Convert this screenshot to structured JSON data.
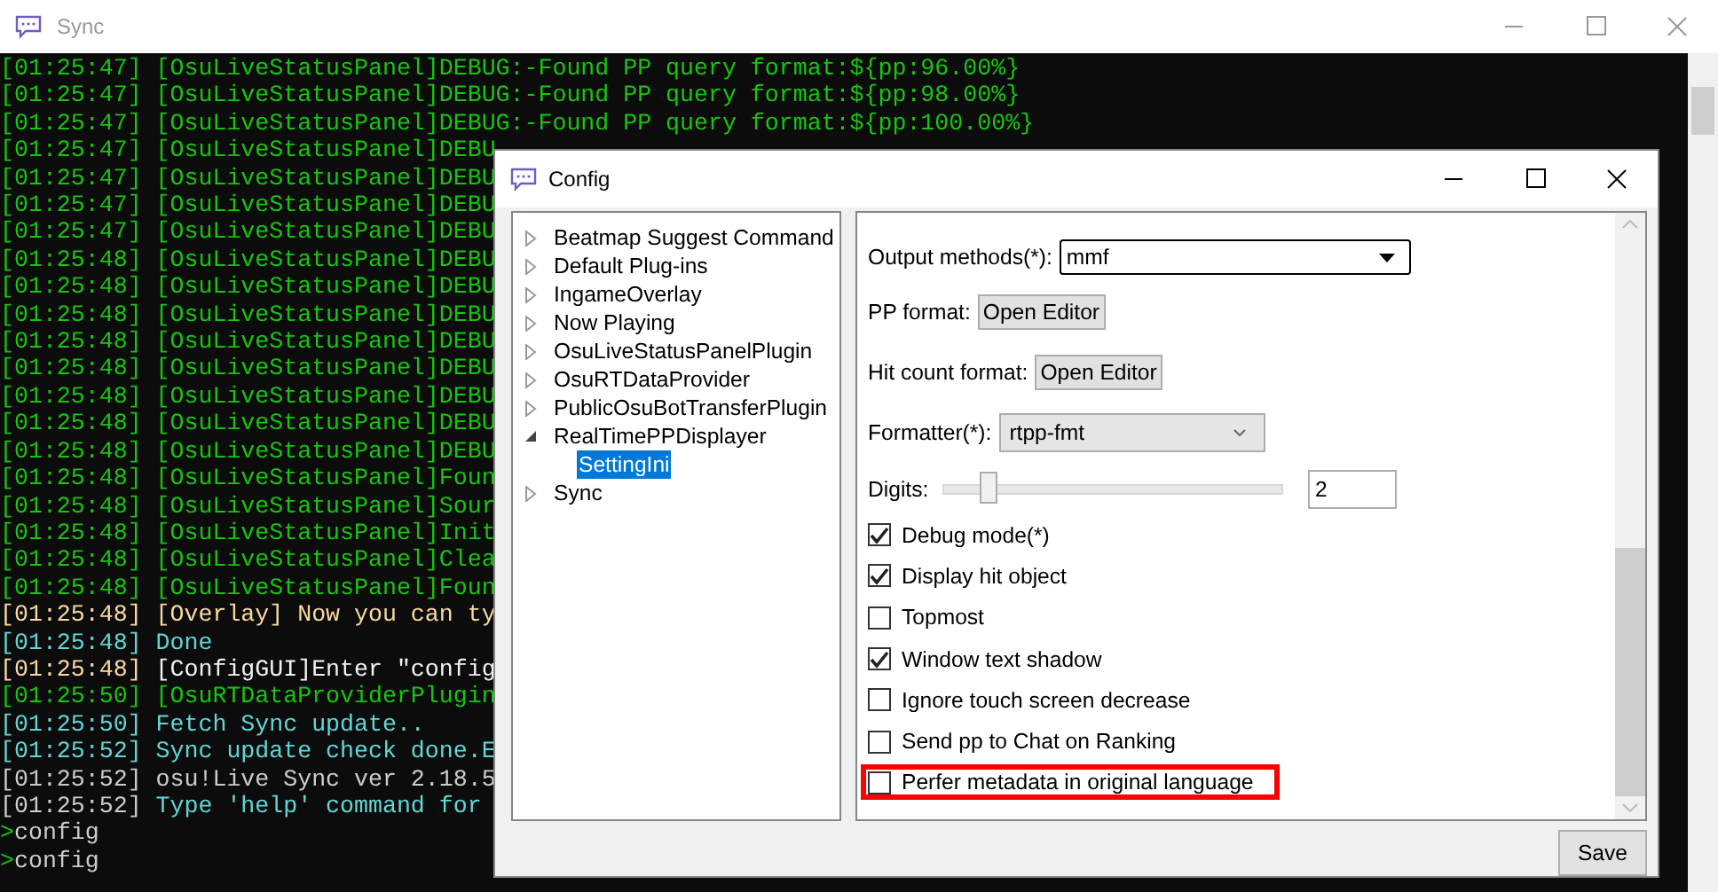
{
  "window": {
    "title": "Sync"
  },
  "console": {
    "lines": [
      {
        "time": {
          "text": "[01:25:47]",
          "color": "#16c60c"
        },
        "message": {
          "text": "[OsuLiveStatusPanel]DEBUG:-Found PP query format:${pp:96.00%}",
          "color": "#16c60c"
        }
      },
      {
        "time": {
          "text": "[01:25:47]",
          "color": "#16c60c"
        },
        "message": {
          "text": "[OsuLiveStatusPanel]DEBUG:-Found PP query format:${pp:98.00%}",
          "color": "#16c60c"
        }
      },
      {
        "time": {
          "text": "[01:25:47]",
          "color": "#16c60c"
        },
        "message": {
          "text": "[OsuLiveStatusPanel]DEBUG:-Found PP query format:${pp:100.00%}",
          "color": "#16c60c"
        }
      },
      {
        "time": {
          "text": "[01:25:47]",
          "color": "#16c60c"
        },
        "message": {
          "text": "[OsuLiveStatusPanel]DEBU",
          "color": "#16c60c"
        }
      },
      {
        "time": {
          "text": "[01:25:47]",
          "color": "#16c60c"
        },
        "message": {
          "text": "[OsuLiveStatusPanel]DEBU",
          "color": "#16c60c"
        }
      },
      {
        "time": {
          "text": "[01:25:47]",
          "color": "#16c60c"
        },
        "message": {
          "text": "[OsuLiveStatusPanel]DEBU",
          "color": "#16c60c"
        }
      },
      {
        "time": {
          "text": "[01:25:47]",
          "color": "#16c60c"
        },
        "message": {
          "text": "[OsuLiveStatusPanel]DEBU",
          "color": "#16c60c"
        }
      },
      {
        "time": {
          "text": "[01:25:48]",
          "color": "#16c60c"
        },
        "message": {
          "text": "[OsuLiveStatusPanel]DEBU",
          "color": "#16c60c"
        }
      },
      {
        "time": {
          "text": "[01:25:48]",
          "color": "#16c60c"
        },
        "message": {
          "text": "[OsuLiveStatusPanel]DEBU",
          "color": "#16c60c"
        }
      },
      {
        "time": {
          "text": "[01:25:48]",
          "color": "#16c60c"
        },
        "message": {
          "text": "[OsuLiveStatusPanel]DEBU",
          "color": "#16c60c"
        }
      },
      {
        "time": {
          "text": "[01:25:48]",
          "color": "#16c60c"
        },
        "message": {
          "text": "[OsuLiveStatusPanel]DEBU",
          "color": "#16c60c"
        }
      },
      {
        "time": {
          "text": "[01:25:48]",
          "color": "#16c60c"
        },
        "message": {
          "text": "[OsuLiveStatusPanel]DEBU",
          "color": "#16c60c"
        }
      },
      {
        "time": {
          "text": "[01:25:48]",
          "color": "#16c60c"
        },
        "message": {
          "text": "[OsuLiveStatusPanel]DEBU",
          "color": "#16c60c"
        }
      },
      {
        "time": {
          "text": "[01:25:48]",
          "color": "#16c60c"
        },
        "message": {
          "text": "[OsuLiveStatusPanel]DEBU",
          "color": "#16c60c"
        }
      },
      {
        "time": {
          "text": "[01:25:48]",
          "color": "#16c60c"
        },
        "message": {
          "text": "[OsuLiveStatusPanel]DEBU",
          "color": "#16c60c"
        }
      },
      {
        "time": {
          "text": "[01:25:48]",
          "color": "#16c60c"
        },
        "message": {
          "text": "[OsuLiveStatusPanel]Foun",
          "color": "#16c60c"
        }
      },
      {
        "time": {
          "text": "[01:25:48]",
          "color": "#16c60c"
        },
        "message": {
          "text": "[OsuLiveStatusPanel]Sour",
          "color": "#16c60c"
        }
      },
      {
        "time": {
          "text": "[01:25:48]",
          "color": "#16c60c"
        },
        "message": {
          "text": "[OsuLiveStatusPanel]Init",
          "color": "#16c60c"
        }
      },
      {
        "time": {
          "text": "[01:25:48]",
          "color": "#16c60c"
        },
        "message": {
          "text": "[OsuLiveStatusPanel]Clea",
          "color": "#16c60c"
        }
      },
      {
        "time": {
          "text": "[01:25:48]",
          "color": "#16c60c"
        },
        "message": {
          "text": "[OsuLiveStatusPanel]Foun",
          "color": "#16c60c"
        }
      },
      {
        "time": {
          "text": "[01:25:48]",
          "color": "#f9d9a0"
        },
        "message": {
          "text": "[Overlay] Now you can ty",
          "color": "#f9d9a0"
        }
      },
      {
        "time": {
          "text": "[01:25:48]",
          "color": "#61d6d6"
        },
        "message": {
          "text": "Done",
          "color": "#61d6d6"
        }
      },
      {
        "time": {
          "text": "[01:25:48]",
          "color": "#f9d9a0"
        },
        "message": {
          "text": "[ConfigGUI]Enter \"config",
          "color": "#f2f2f2"
        }
      },
      {
        "time": {
          "text": "[01:25:50]",
          "color": "#16c60c"
        },
        "message": {
          "text": "[OsuRTDataProviderPlugin",
          "color": "#16c60c"
        }
      },
      {
        "time": {
          "text": "[01:25:50]",
          "color": "#61d6d6"
        },
        "message": {
          "text": "Fetch Sync update..",
          "color": "#61d6d6"
        }
      },
      {
        "time": {
          "text": "[01:25:52]",
          "color": "#61d6d6"
        },
        "message": {
          "text": "Sync update check done.E",
          "color": "#61d6d6"
        }
      },
      {
        "time": {
          "text": "[01:25:52]",
          "color": "#cccccc"
        },
        "message": {
          "text": "osu!Live Sync ver 2.18.5",
          "color": "#cccccc"
        }
      },
      {
        "time": {
          "text": "[01:25:52]",
          "color": "#cccccc"
        },
        "message": {
          "text": "Type 'help' command for",
          "color": "#61d6d6"
        }
      }
    ],
    "prompts": [
      {
        "mark": ">",
        "text": "config"
      },
      {
        "mark": ">",
        "text": "config"
      }
    ]
  },
  "config_window": {
    "title": "Config",
    "tree": [
      {
        "label": "Beatmap Suggest Command",
        "expanded": false,
        "selected": false
      },
      {
        "label": "Default Plug-ins",
        "expanded": false,
        "selected": false
      },
      {
        "label": "IngameOverlay",
        "expanded": false,
        "selected": false
      },
      {
        "label": "Now Playing",
        "expanded": false,
        "selected": false
      },
      {
        "label": "OsuLiveStatusPanelPlugin",
        "expanded": false,
        "selected": false
      },
      {
        "label": "OsuRTDataProvider",
        "expanded": false,
        "selected": false
      },
      {
        "label": "PublicOsuBotTransferPlugin",
        "expanded": false,
        "selected": false
      },
      {
        "label": "RealTimePPDisplayer",
        "expanded": true,
        "selected": false,
        "children": [
          {
            "label": "SettingIni",
            "selected": true
          }
        ]
      },
      {
        "label": "Sync",
        "expanded": false,
        "selected": false
      }
    ],
    "settings": [
      {
        "kind": "select",
        "label": "Output methods(*):",
        "value": "mmf"
      },
      {
        "kind": "button",
        "label": "PP format:",
        "button": "Open Editor"
      },
      {
        "kind": "button",
        "label": "Hit count format:",
        "button": "Open Editor"
      },
      {
        "kind": "combo",
        "label": "Formatter(*):",
        "value": "rtpp-fmt"
      },
      {
        "kind": "slider",
        "label": "Digits:",
        "level": 0.13,
        "value": "2"
      },
      {
        "kind": "checkbox",
        "label": "Debug mode(*)",
        "checked": true,
        "highlighted": false
      },
      {
        "kind": "checkbox",
        "label": "Display hit object",
        "checked": true,
        "highlighted": false
      },
      {
        "kind": "checkbox",
        "label": "Topmost",
        "checked": false,
        "highlighted": false
      },
      {
        "kind": "checkbox",
        "label": "Window text shadow",
        "checked": true,
        "highlighted": false
      },
      {
        "kind": "checkbox",
        "label": "Ignore touch screen decrease",
        "checked": false,
        "highlighted": false
      },
      {
        "kind": "checkbox",
        "label": "Send pp to Chat on Ranking",
        "checked": false,
        "highlighted": false
      },
      {
        "kind": "checkbox",
        "label": "Perfer metadata in original language",
        "checked": false,
        "highlighted": true
      }
    ],
    "save_button": "Save"
  }
}
